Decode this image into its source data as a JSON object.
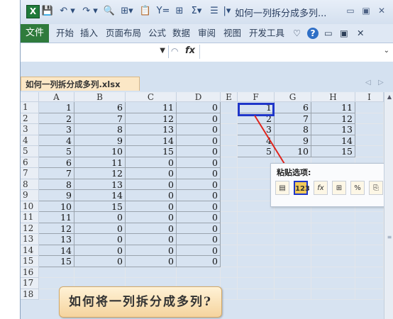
{
  "titlebar": {
    "title": "如何一列拆分成多列...",
    "icons": [
      "excel-logo",
      "save-icon",
      "undo-icon",
      "redo-icon",
      "print-preview-icon",
      "border-icon",
      "paste-special-icon",
      "filter-icon",
      "grid-icon",
      "sum-icon",
      "sort-icon",
      "customize-icon"
    ]
  },
  "ribbon": {
    "file_tab": "文件",
    "tabs": [
      "开始",
      "插入",
      "页面布局",
      "公式",
      "数据",
      "审阅",
      "视图",
      "开发工具"
    ]
  },
  "formula_bar": {
    "fx_label": "fx",
    "namebox_value": ""
  },
  "workbook": {
    "tab_label": "如何一列拆分成多列.xlsx"
  },
  "columns": [
    "A",
    "B",
    "C",
    "D",
    "E",
    "F",
    "G",
    "H",
    "I"
  ],
  "rows": [
    {
      "n": "1",
      "a": "1",
      "b": "6",
      "c": "11",
      "d": "0"
    },
    {
      "n": "2",
      "a": "2",
      "b": "7",
      "c": "12",
      "d": "0"
    },
    {
      "n": "3",
      "a": "3",
      "b": "8",
      "c": "13",
      "d": "0"
    },
    {
      "n": "4",
      "a": "4",
      "b": "9",
      "c": "14",
      "d": "0"
    },
    {
      "n": "5",
      "a": "5",
      "b": "10",
      "c": "15",
      "d": "0"
    },
    {
      "n": "6",
      "a": "6",
      "b": "11",
      "c": "0",
      "d": "0"
    },
    {
      "n": "7",
      "a": "7",
      "b": "12",
      "c": "0",
      "d": "0"
    },
    {
      "n": "8",
      "a": "8",
      "b": "13",
      "c": "0",
      "d": "0"
    },
    {
      "n": "9",
      "a": "9",
      "b": "14",
      "c": "0",
      "d": "0"
    },
    {
      "n": "10",
      "a": "10",
      "b": "15",
      "c": "0",
      "d": "0"
    },
    {
      "n": "11",
      "a": "11",
      "b": "0",
      "c": "0",
      "d": "0"
    },
    {
      "n": "12",
      "a": "12",
      "b": "0",
      "c": "0",
      "d": "0"
    },
    {
      "n": "13",
      "a": "13",
      "b": "0",
      "c": "0",
      "d": "0"
    },
    {
      "n": "14",
      "a": "14",
      "b": "0",
      "c": "0",
      "d": "0"
    },
    {
      "n": "15",
      "a": "15",
      "b": "0",
      "c": "0",
      "d": "0"
    },
    {
      "n": "16"
    },
    {
      "n": "17"
    },
    {
      "n": "18"
    }
  ],
  "pasted": [
    {
      "f": "1",
      "g": "6",
      "h": "11"
    },
    {
      "f": "2",
      "g": "7",
      "h": "12"
    },
    {
      "f": "3",
      "g": "8",
      "h": "13"
    },
    {
      "f": "4",
      "g": "9",
      "h": "14"
    },
    {
      "f": "5",
      "g": "10",
      "h": "15"
    }
  ],
  "paste_options": {
    "title": "粘贴选项:",
    "buttons": [
      {
        "icon": "paste-icon",
        "label": ""
      },
      {
        "icon": "paste-values-icon",
        "label": "123"
      },
      {
        "icon": "paste-formulas-icon",
        "label": "fx"
      },
      {
        "icon": "paste-formatting-icon",
        "label": ""
      },
      {
        "icon": "paste-percent-icon",
        "label": "%"
      },
      {
        "icon": "paste-link-icon",
        "label": ""
      }
    ]
  },
  "caption": "如何将一列拆分成多列?",
  "colors": {
    "accent": "#1f36c9",
    "file_tab": "#2f7b3c",
    "arrow": "#e0231b"
  }
}
